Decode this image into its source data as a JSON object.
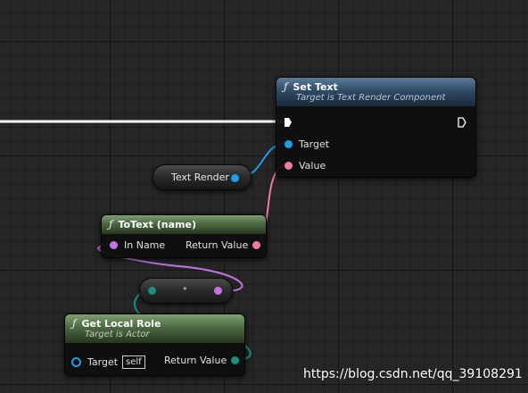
{
  "set_text_node": {
    "title": "Set Text",
    "subtitle": "Target is Text Render Component",
    "function_icon": "ƒ",
    "pins": {
      "target": "Target",
      "value": "Value"
    }
  },
  "text_render_node": {
    "label": "Text Render"
  },
  "totext_node": {
    "title": "ToText (name)",
    "function_icon": "ƒ",
    "pins": {
      "in_name": "In Name",
      "return_value": "Return Value"
    }
  },
  "reroute_node": {
    "label": "•"
  },
  "get_local_role_node": {
    "title": "Get Local Role",
    "subtitle": "Target is Actor",
    "function_icon": "ƒ",
    "pins": {
      "target": "Target",
      "target_default": "self",
      "return_value": "Return Value"
    }
  },
  "watermark": {
    "text": "https://blog.csdn.net/qq_39108291"
  },
  "colors": {
    "exec_wire": "#ffffff",
    "object_pin": "#1f9dec",
    "text_pin": "#f17ba6",
    "name_pin": "#c872e8",
    "enum_pin": "#1b8f80"
  }
}
